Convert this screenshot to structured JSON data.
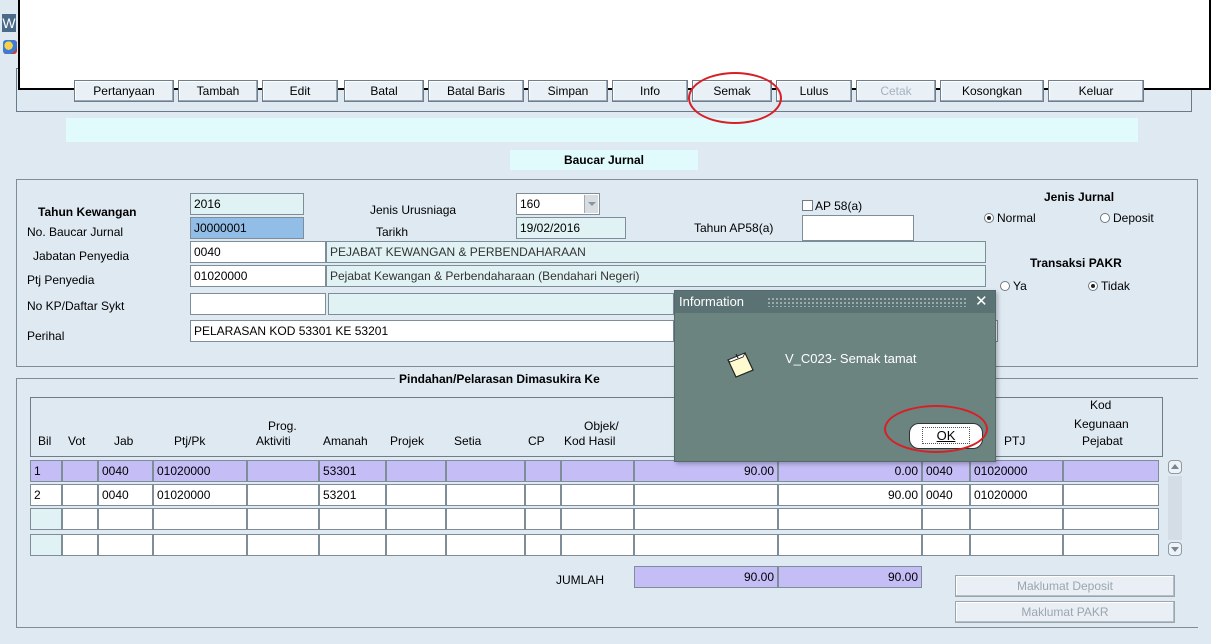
{
  "window": {
    "title_char": "W"
  },
  "toolbar": {
    "buttons": [
      "Pertanyaan",
      "Tambah",
      "Edit",
      "Batal",
      "Batal Baris",
      "Simpan",
      "Info",
      "Semak",
      "Lulus",
      "Cetak",
      "Kosongkan",
      "Keluar"
    ],
    "disabled": [
      "Cetak"
    ]
  },
  "form": {
    "title": "Baucar Jurnal",
    "tahun_kewangan_label": "Tahun Kewangan",
    "tahun_kewangan": "2016",
    "no_baucar_label": "No. Baucar Jurnal",
    "no_baucar": "J0000001",
    "jabatan_label": "Jabatan Penyedia",
    "jabatan_code": "0040",
    "jabatan_name": "PEJABAT KEWANGAN & PERBENDAHARAAN",
    "ptj_label": "Ptj Penyedia",
    "ptj_code": "01020000",
    "ptj_name": "Pejabat Kewangan & Perbendaharaan (Bendahari Negeri)",
    "nokp_label": "No KP/Daftar Sykt",
    "nokp_value": "",
    "perihal_label": "Perihal",
    "perihal": "PELARASAN KOD 53301 KE 53201",
    "jenis_urusniaga_label": "Jenis Urusniaga",
    "jenis_urusniaga": "160",
    "tarikh_label": "Tarikh",
    "tarikh": "19/02/2016",
    "ap58_label": "AP 58(a)",
    "tahun_ap58_label": "Tahun AP58(a)",
    "tahun_ap58": "",
    "jenis_jurnal_label": "Jenis Jurnal",
    "normal_label": "Normal",
    "deposit_label": "Deposit",
    "transaksi_label": "Transaksi PAKR",
    "ya_label": "Ya",
    "tidak_label": "Tidak"
  },
  "section": {
    "title": "Pindahan/Pelarasan Dimasukira Ke"
  },
  "grid": {
    "headers": {
      "bil": "Bil",
      "vot": "Vot",
      "jab": "Jab",
      "ptj_pk": "Ptj/Pk",
      "prog_1": "Prog.",
      "prog_2": "Aktiviti",
      "amanah": "Amanah",
      "projek": "Projek",
      "setia": "Setia",
      "cp": "CP",
      "objek_1": "Objek/",
      "objek_2": "Kod Hasil",
      "ptj": "PTJ",
      "kod_1": "Kod",
      "kod_2": "Kegunaan",
      "kod_3": "Pejabat"
    },
    "rows": [
      {
        "bil": "1",
        "vot": "",
        "jab": "0040",
        "ptj": "01020000",
        "prog": "",
        "amanah": "53301",
        "projek": "",
        "setia": "",
        "cp": "",
        "objek": "",
        "debit": "90.00",
        "kredit": "0.00",
        "jab2": "0040",
        "ptj2": "01020000",
        "kod": ""
      },
      {
        "bil": "2",
        "vot": "",
        "jab": "0040",
        "ptj": "01020000",
        "prog": "",
        "amanah": "53201",
        "projek": "",
        "setia": "",
        "cp": "",
        "objek": "",
        "debit": "",
        "kredit": "90.00",
        "jab2": "0040",
        "ptj2": "01020000",
        "kod": ""
      }
    ],
    "jumlah_label": "JUMLAH",
    "jumlah_debit": "90.00",
    "jumlah_kredit": "90.00"
  },
  "buttons": {
    "maklumat_deposit": "Maklumat Deposit",
    "maklumat_pakr": "Maklumat PAKR"
  },
  "dialog": {
    "title": "Information",
    "message": "V_C023- Semak tamat",
    "ok_label": "OK",
    "close_glyph": "✕"
  }
}
